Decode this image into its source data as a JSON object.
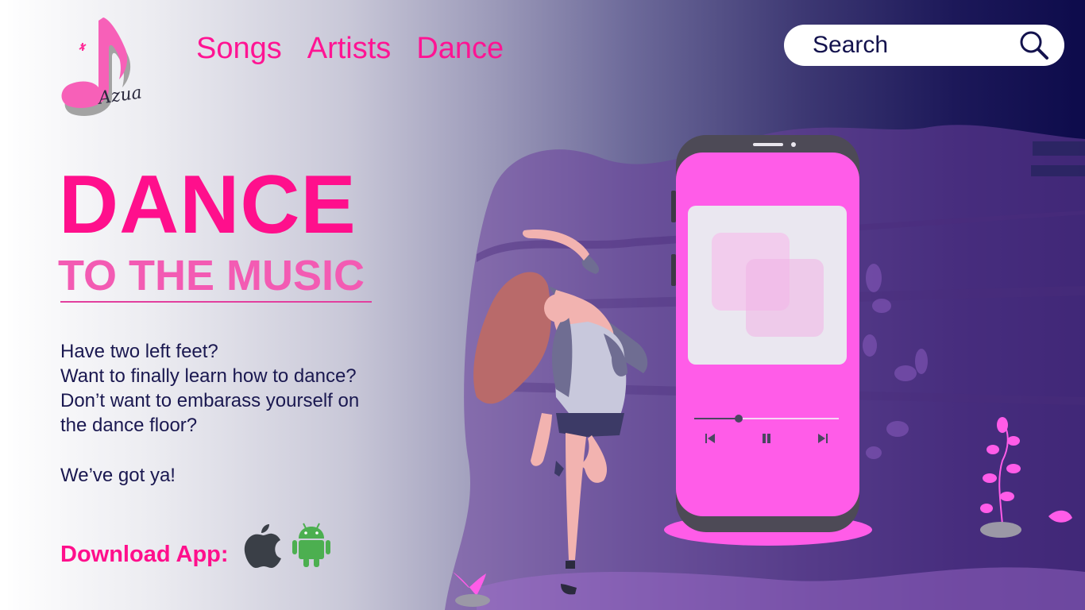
{
  "brand": {
    "logo_text": "Azua"
  },
  "nav": {
    "items": [
      {
        "label": "Songs"
      },
      {
        "label": "Artists"
      },
      {
        "label": "Dance"
      }
    ]
  },
  "search": {
    "placeholder": "Search"
  },
  "hero": {
    "title": "DANCE",
    "subtitle": "TO THE MUSIC",
    "body_lines": [
      "Have two left feet?",
      "Want to finally learn how to dance?",
      "Don’t want to embarass yourself on",
      "the dance floor?"
    ],
    "tagline": "We’ve got ya!"
  },
  "download": {
    "label": "Download App:",
    "stores": [
      {
        "icon": "apple-icon"
      },
      {
        "icon": "android-icon"
      }
    ]
  },
  "player": {
    "progress": 0.31
  },
  "colors": {
    "accent": "#ff0f8c",
    "accent_light": "#f35bb3",
    "phone_pink": "#ff5ce8",
    "navy": "#0d0b4b",
    "text_dark": "#1a1850",
    "android_green": "#4caf50",
    "apple_gray": "#3a3f47"
  }
}
